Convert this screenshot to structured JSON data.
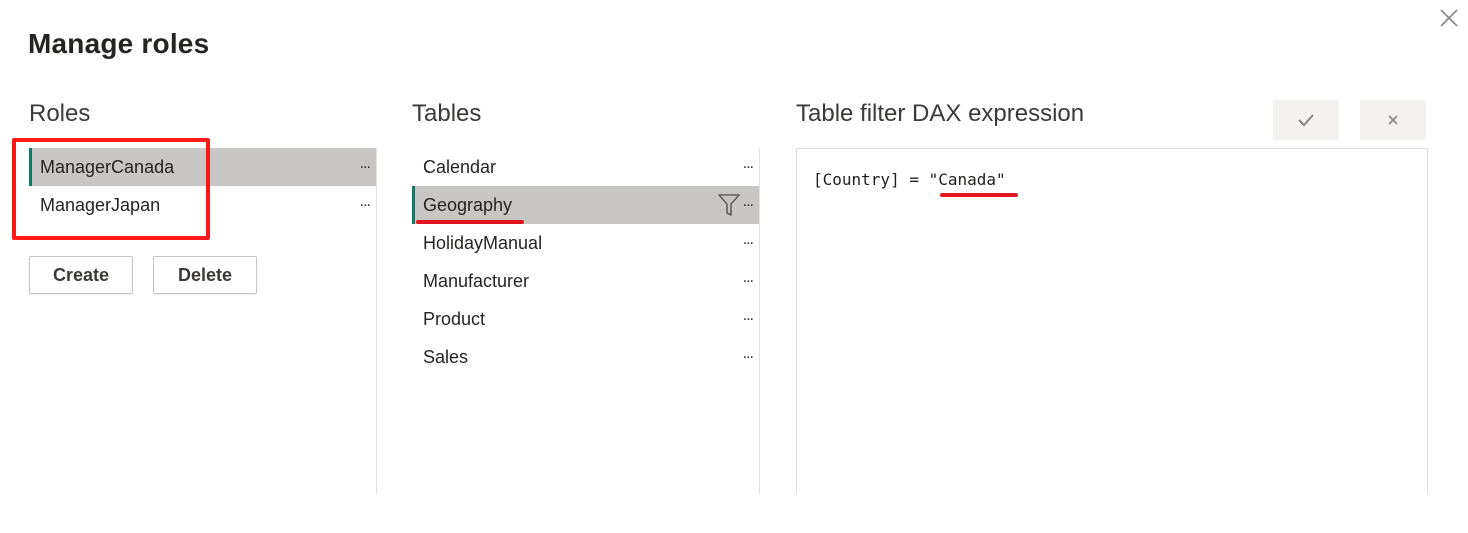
{
  "dialog": {
    "title": "Manage roles",
    "close_icon": "close-icon"
  },
  "roles": {
    "heading": "Roles",
    "items": [
      {
        "label": "ManagerCanada",
        "more": "...",
        "selected": true
      },
      {
        "label": "ManagerJapan",
        "more": "...",
        "selected": false
      }
    ],
    "create_label": "Create",
    "delete_label": "Delete"
  },
  "tables": {
    "heading": "Tables",
    "items": [
      {
        "label": "Calendar",
        "more": "..."
      },
      {
        "label": "Geography",
        "more": "...",
        "selected": true,
        "filtered": true
      },
      {
        "label": "HolidayManual",
        "more": "..."
      },
      {
        "label": "Manufacturer",
        "more": "..."
      },
      {
        "label": "Product",
        "more": "..."
      },
      {
        "label": "Sales",
        "more": "..."
      }
    ],
    "filter_icon": "filter-icon"
  },
  "dax": {
    "heading": "Table filter DAX expression",
    "expression": "[Country] = \"Canada\"",
    "confirm_icon": "checkmark-icon",
    "cancel_icon": "cancel-x-icon"
  },
  "colors": {
    "accent": "#117865",
    "selected_bg": "#c8c6c4",
    "annotation": "#ff1a1a"
  }
}
